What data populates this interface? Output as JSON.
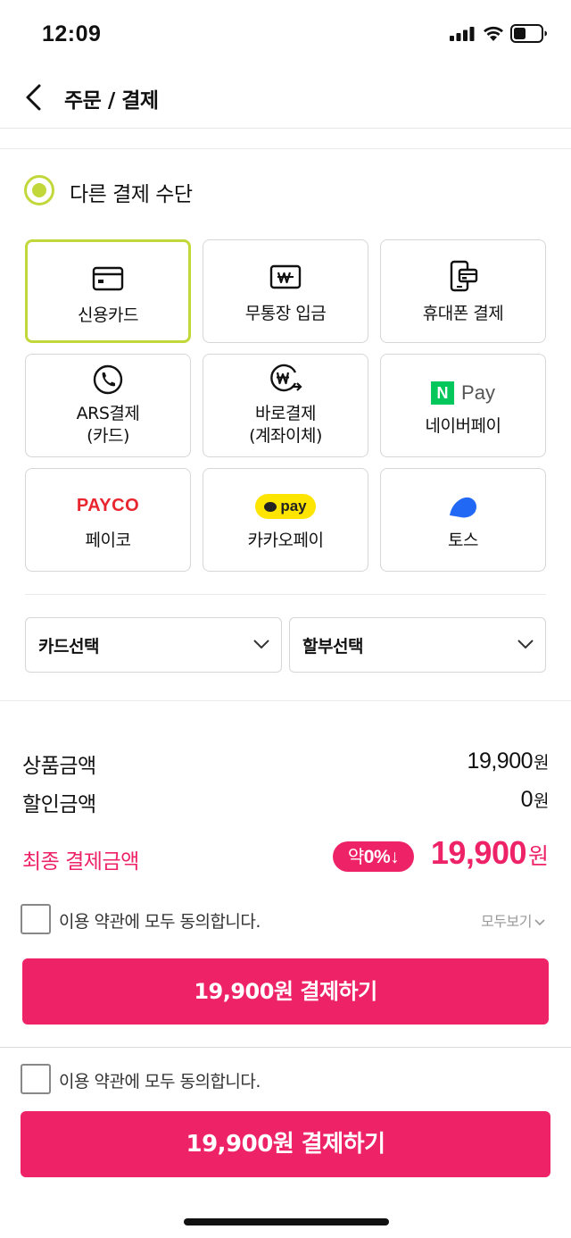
{
  "status_bar": {
    "time": "12:09"
  },
  "header": {
    "title": "주문 / 결제"
  },
  "payment": {
    "method_label": "다른 결제 수단",
    "options": [
      {
        "label": "신용카드",
        "icon": "credit-card-icon"
      },
      {
        "label": "무통장 입금",
        "icon": "won-bill-icon"
      },
      {
        "label": "휴대폰 결제",
        "icon": "mobile-pay-icon"
      },
      {
        "label": "ARS결제\n(카드)",
        "icon": "phone-call-icon"
      },
      {
        "label": "바로결제\n(계좌이체)",
        "icon": "won-transfer-icon"
      },
      {
        "label": "네이버페이",
        "icon": "naver-pay-logo",
        "logo_n": "N",
        "logo_text": "Pay"
      },
      {
        "label": "페이코",
        "icon": "payco-logo",
        "logo_text": "PAYCO"
      },
      {
        "label": "카카오페이",
        "icon": "kakao-pay-logo",
        "logo_text": "pay"
      },
      {
        "label": "토스",
        "icon": "toss-logo"
      }
    ],
    "card_select": "카드선택",
    "installment_select": "할부선택"
  },
  "summary": {
    "product_amount_label": "상품금액",
    "product_amount": "19,900",
    "discount_amount_label": "할인금액",
    "discount_amount": "0",
    "currency": "원",
    "final_label": "최종 결제금액",
    "discount_badge_prefix": "약",
    "discount_badge_value": "0%↓",
    "final_amount": "19,900"
  },
  "terms": {
    "agree_text": "이용 약관에 모두 동의합니다.",
    "see_all": "모두보기"
  },
  "pay_button": "19,900원 결제하기",
  "bottom_bar": {
    "agree_text": "이용 약관에 모두 동의합니다.",
    "pay_button": "19,900원 결제하기"
  },
  "colors": {
    "accent_green": "#c2d83a",
    "accent_pink": "#ee2266",
    "naver_green": "#03c75a",
    "kakao_yellow": "#fee500",
    "toss_blue": "#2168f5",
    "payco_red": "#e8262d"
  }
}
